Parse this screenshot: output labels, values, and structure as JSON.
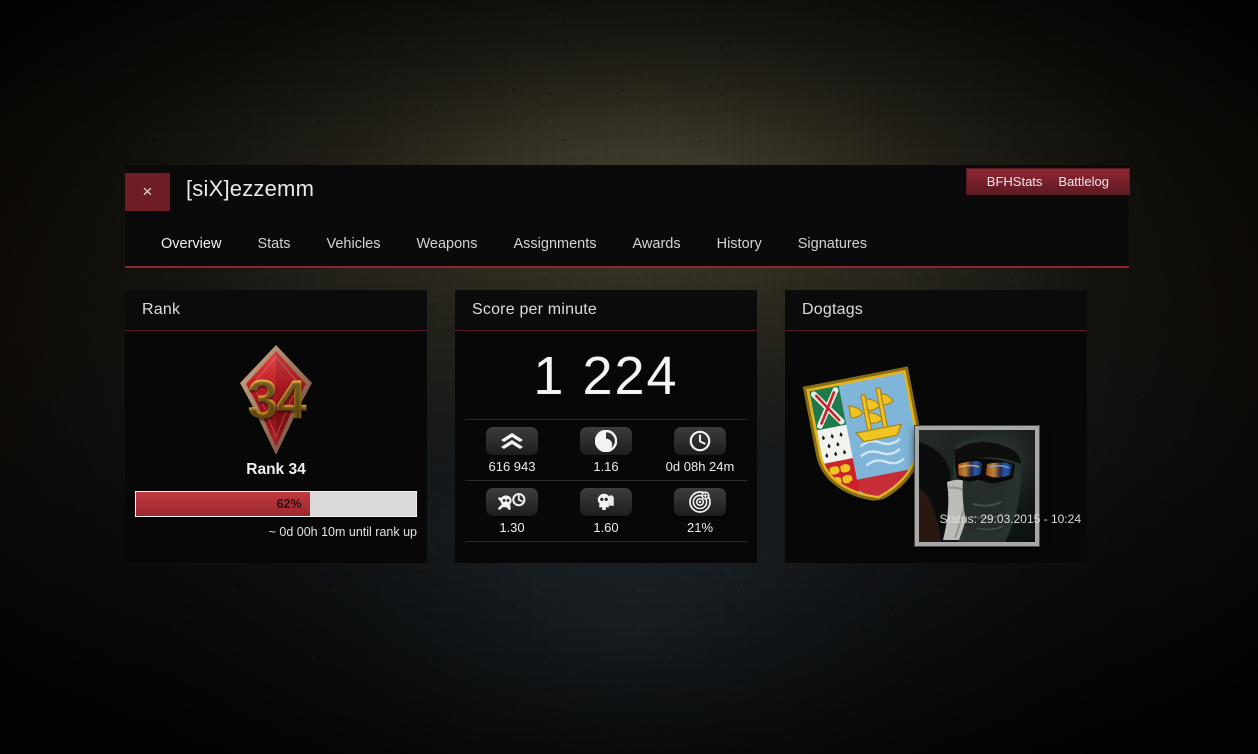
{
  "window": {
    "close_label": "×",
    "player_name": "[siX]ezzemm",
    "external_links": [
      {
        "label": "BFHStats"
      },
      {
        "label": "Battlelog"
      }
    ],
    "nav": [
      {
        "label": "Overview",
        "active": true
      },
      {
        "label": "Stats",
        "active": false
      },
      {
        "label": "Vehicles",
        "active": false
      },
      {
        "label": "Weapons",
        "active": false
      },
      {
        "label": "Assignments",
        "active": false
      },
      {
        "label": "Awards",
        "active": false
      },
      {
        "label": "History",
        "active": false
      },
      {
        "label": "Signatures",
        "active": false
      }
    ]
  },
  "rank_panel": {
    "title": "Rank",
    "badge_number": "34",
    "rank_label": "Rank 34",
    "progress_percent_label": "62%",
    "progress_percent": 62,
    "rank_up_note": "~ 0d 00h 10m until rank up"
  },
  "score_panel": {
    "title": "Score per minute",
    "value": "1 224",
    "stats": [
      {
        "icon": "chevrons-up-icon",
        "value": "616 943"
      },
      {
        "icon": "score-ratio-icon",
        "value": "1.16"
      },
      {
        "icon": "clock-icon",
        "value": "0d 08h 24m"
      },
      {
        "icon": "skull-crossbones-timer-icon",
        "value": "1.30"
      },
      {
        "icon": "skull-bullet-icon",
        "value": "1.60"
      },
      {
        "icon": "accuracy-target-icon",
        "value": "21%"
      }
    ]
  },
  "dogtags_panel": {
    "title": "Dogtags",
    "basic_tag_name": "saint-pierre-miquelon-shield-dogtag",
    "photo_tag_name": "photo-dogtag",
    "status": "Status: 29.03.2015 - 10:24"
  },
  "colors": {
    "accent_red": "#8e2430",
    "link_bar_red": "#78202a",
    "panel_bg": "#070707",
    "progress_fill": "#ab2f36",
    "text_primary": "#ededed"
  }
}
